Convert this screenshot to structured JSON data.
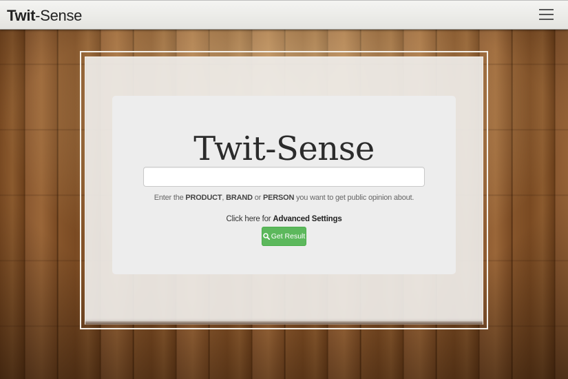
{
  "navbar": {
    "brand_bold": "Twit",
    "brand_rest": "-Sense"
  },
  "main": {
    "title": "Twit-Sense",
    "search": {
      "value": "",
      "placeholder": ""
    },
    "hint": {
      "prefix": "Enter the ",
      "product": "PRODUCT",
      "sep1": ", ",
      "brand": "BRAND",
      "sep2": " or ",
      "person": "PERSON",
      "suffix": " you want to get public opinion about."
    },
    "advanced": {
      "prefix": "Click here for ",
      "link": "Advanced Settings"
    },
    "button": {
      "label": "Get Result",
      "icon": "search-icon",
      "color": "#5cb85c"
    }
  }
}
